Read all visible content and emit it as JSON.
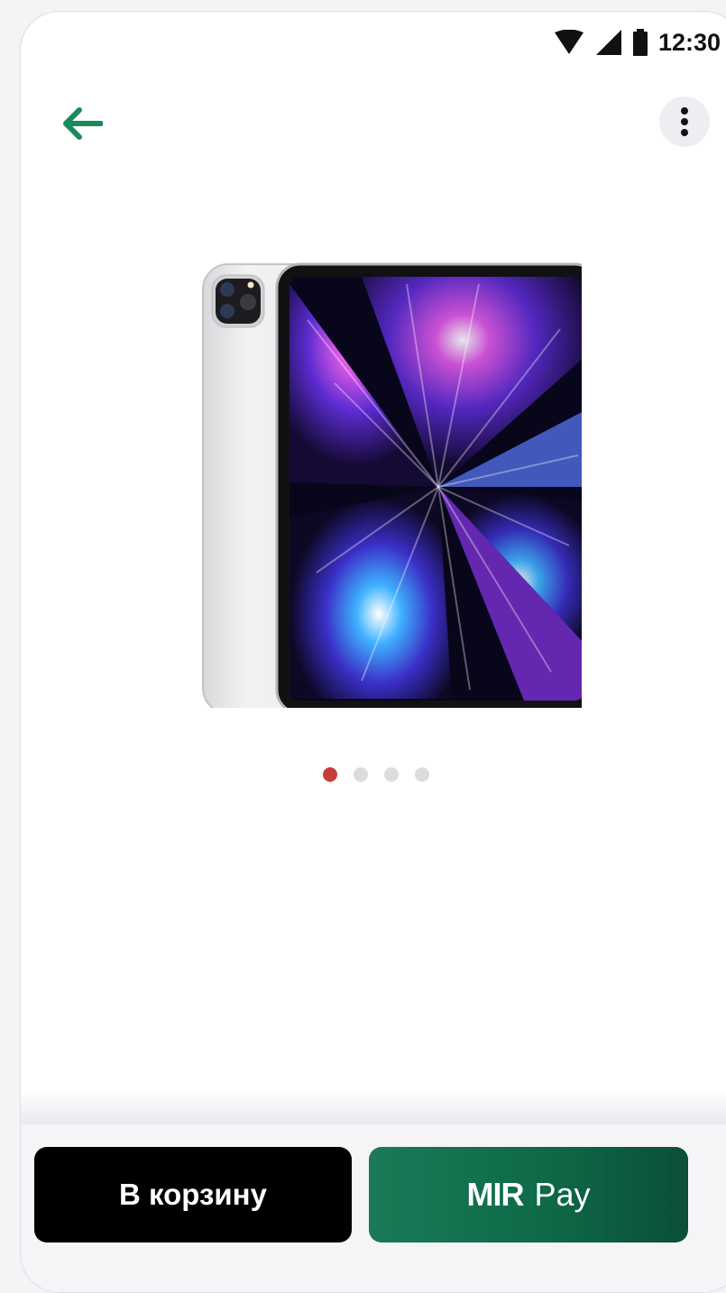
{
  "status_bar": {
    "time": "12:30",
    "icons": [
      "wifi-icon",
      "signal-icon",
      "battery-icon"
    ]
  },
  "top_bar": {
    "back_icon": "arrow-left-icon",
    "menu_icon": "more-vert-icon",
    "accent_color": "#1b8a5a"
  },
  "product": {
    "image": "ipad-pro-silver-image"
  },
  "pager": {
    "total": 4,
    "active_index": 0,
    "active_color": "#c83c3c"
  },
  "actions": {
    "cart_label": "В корзину",
    "mir_brand": "MIR",
    "mir_pay_label": "Pay",
    "mir_color": "#0e6a48"
  }
}
